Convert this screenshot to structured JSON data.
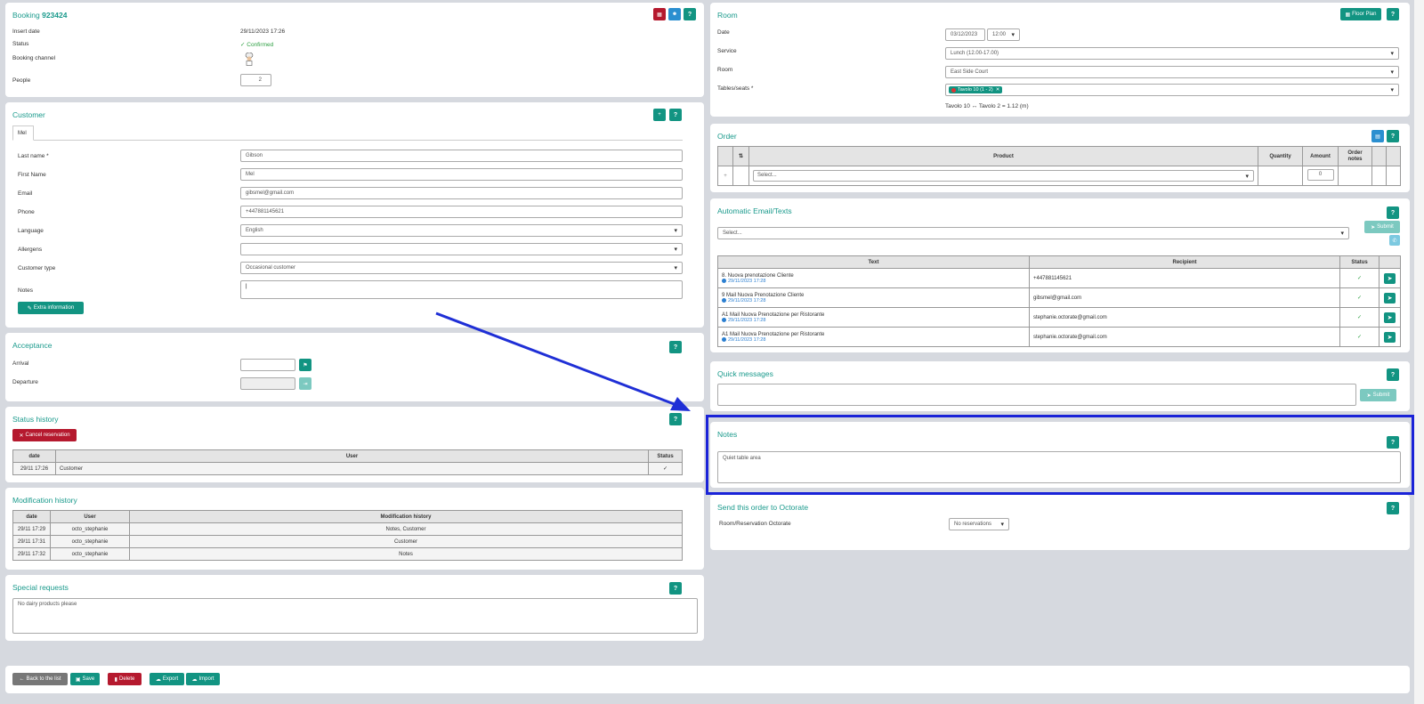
{
  "booking": {
    "title": "Booking",
    "number": "923424",
    "rows": [
      {
        "label": "Insert date",
        "value": "29/11/2023 17:26"
      },
      {
        "label": "Status",
        "value": "✓ Confirmed"
      },
      {
        "label": "Booking channel",
        "value": ""
      },
      {
        "label": "People",
        "value": "2"
      }
    ]
  },
  "customer": {
    "title": "Customer",
    "tab": "Mel",
    "fields": [
      {
        "label": "Last name *",
        "value": "Gibson"
      },
      {
        "label": "First Name",
        "value": "Mel"
      },
      {
        "label": "Email",
        "value": "gibsmel@gmail.com"
      },
      {
        "label": "Phone",
        "value": "+447881145621"
      },
      {
        "label": "Language",
        "value": "English"
      },
      {
        "label": "Allergens",
        "value": ""
      },
      {
        "label": "Customer type",
        "value": "Occasional customer"
      },
      {
        "label": "Notes",
        "value": "|"
      }
    ],
    "extra_button": "Extra information"
  },
  "acceptance": {
    "title": "Acceptance",
    "arrival_label": "Arrival",
    "departure_label": "Departure"
  },
  "status_history": {
    "title": "Status history",
    "cancel_button": "Cancel reservation",
    "headers": [
      "date",
      "User",
      "Status"
    ],
    "rows": [
      {
        "date": "29/11 17:26",
        "user": "Customer",
        "status": "✓"
      }
    ]
  },
  "modification_history": {
    "title": "Modification history",
    "headers": [
      "date",
      "User",
      "Modification history"
    ],
    "rows": [
      {
        "date": "29/11 17:29",
        "user": "octo_stephanie",
        "mod": "Notes, Customer"
      },
      {
        "date": "29/11 17:31",
        "user": "octo_stephanie",
        "mod": "Customer"
      },
      {
        "date": "29/11 17:32",
        "user": "octo_stephanie",
        "mod": "Notes"
      }
    ]
  },
  "special_requests": {
    "title": "Special requests",
    "text": "No dairy products please"
  },
  "footer": {
    "back": "Back to the list",
    "save": "Save",
    "delete": "Delete",
    "export": "Export",
    "import": "Import"
  },
  "room": {
    "title": "Room",
    "floor_plan": "Floor Plan",
    "date_label": "Date",
    "date_value": "03/12/2023",
    "time_value": "12:00",
    "service_label": "Service",
    "service_value": "Lunch (12.00-17.00)",
    "room_label": "Room",
    "room_value": "East Side Court",
    "tables_label": "Tables/seats *",
    "table_tag": "Tavolo 10 (1 - 2)",
    "table_info": "Tavolo 10 ↔ Tavolo 2 = 1.12 (m)"
  },
  "order": {
    "title": "Order",
    "headers": [
      "⇅",
      "Product",
      "Quantity",
      "Amount",
      "Order notes"
    ],
    "select": "Select...",
    "amount": "0",
    "add": "+"
  },
  "auto_emails": {
    "title": "Automatic Email/Texts",
    "select": "Select...",
    "submit": "Submit",
    "headers": [
      "Text",
      "Recipient",
      "Status"
    ],
    "rows": [
      {
        "text": "8. Nuova prenotazione Cliente",
        "time": "29/11/2023 17:28",
        "recipient": "+447881145621",
        "status": "✓"
      },
      {
        "text": "9 Mail Nuova Prenotazione Cliente",
        "time": "29/11/2023 17:28",
        "recipient": "gibsmel@gmail.com",
        "status": "✓"
      },
      {
        "text": "A1 Mail Nuova Prenotazione per Ristorante",
        "time": "29/11/2023 17:28",
        "recipient": "stephanie.octorate@gmail.com",
        "status": "✓"
      },
      {
        "text": "A1 Mail Nuova Prenotazione per Ristorante",
        "time": "29/11/2023 17:28",
        "recipient": "stephanie.octorate@gmail.com",
        "status": "✓"
      }
    ]
  },
  "quick_messages": {
    "title": "Quick messages",
    "submit": "Submit"
  },
  "notes": {
    "title": "Notes",
    "text": "Quiet table area"
  },
  "send_order": {
    "title": "Send this order to Octorate",
    "label": "Room/Reservation Octorate",
    "value": "No reservations"
  },
  "help": "?",
  "colors": {
    "accent": "#129482",
    "danger": "#b5192e",
    "highlight": "#1a23d8",
    "arrow": "#1f2fd6"
  }
}
